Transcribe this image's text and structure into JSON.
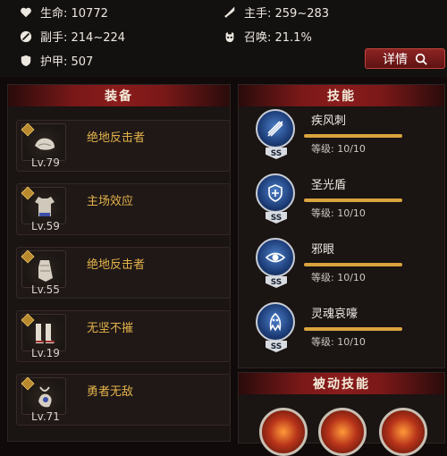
{
  "stats": {
    "hp": "生命: 10772",
    "main_hand": "主手: 259~283",
    "off_hand": "副手: 214~224",
    "summon": "召唤: 21.1%",
    "armor": "护甲: 507"
  },
  "detail_button": {
    "label": "详情"
  },
  "equipment": {
    "title": "装备",
    "items": [
      {
        "name": "绝地反击者",
        "level": "Lv.79",
        "icon": "gloves-icon"
      },
      {
        "name": "主场效应",
        "level": "Lv.59",
        "icon": "chest-armor-icon"
      },
      {
        "name": "绝地反击者",
        "level": "Lv.55",
        "icon": "gauntlet-icon"
      },
      {
        "name": "无坚不摧",
        "level": "Lv.19",
        "icon": "boots-icon"
      },
      {
        "name": "勇者无敌",
        "level": "Lv.71",
        "icon": "amulet-icon"
      }
    ]
  },
  "skills": {
    "title": "技能",
    "items": [
      {
        "name": "疾风刺",
        "rank": "SS",
        "level_text": "等级: 10/10",
        "progress": 1.0,
        "icon": "triple-spear-icon"
      },
      {
        "name": "圣光盾",
        "rank": "SS",
        "level_text": "等级: 10/10",
        "progress": 1.0,
        "icon": "holy-shield-icon"
      },
      {
        "name": "邪眼",
        "rank": "SS",
        "level_text": "等级: 10/10",
        "progress": 1.0,
        "icon": "evil-eye-icon"
      },
      {
        "name": "灵魂哀嚎",
        "rank": "SS",
        "level_text": "等级: 10/10",
        "progress": 1.0,
        "icon": "soul-wail-icon"
      }
    ]
  },
  "passive": {
    "title": "被动技能",
    "icons": [
      "fire-skill-icon",
      "fire-skill-icon",
      "fire-skill-icon"
    ]
  },
  "colors": {
    "accent_red": "#8a1c1c",
    "gold": "#e3b24a",
    "bar": "#d9a43e",
    "skill_blue": "#1d3d78"
  }
}
